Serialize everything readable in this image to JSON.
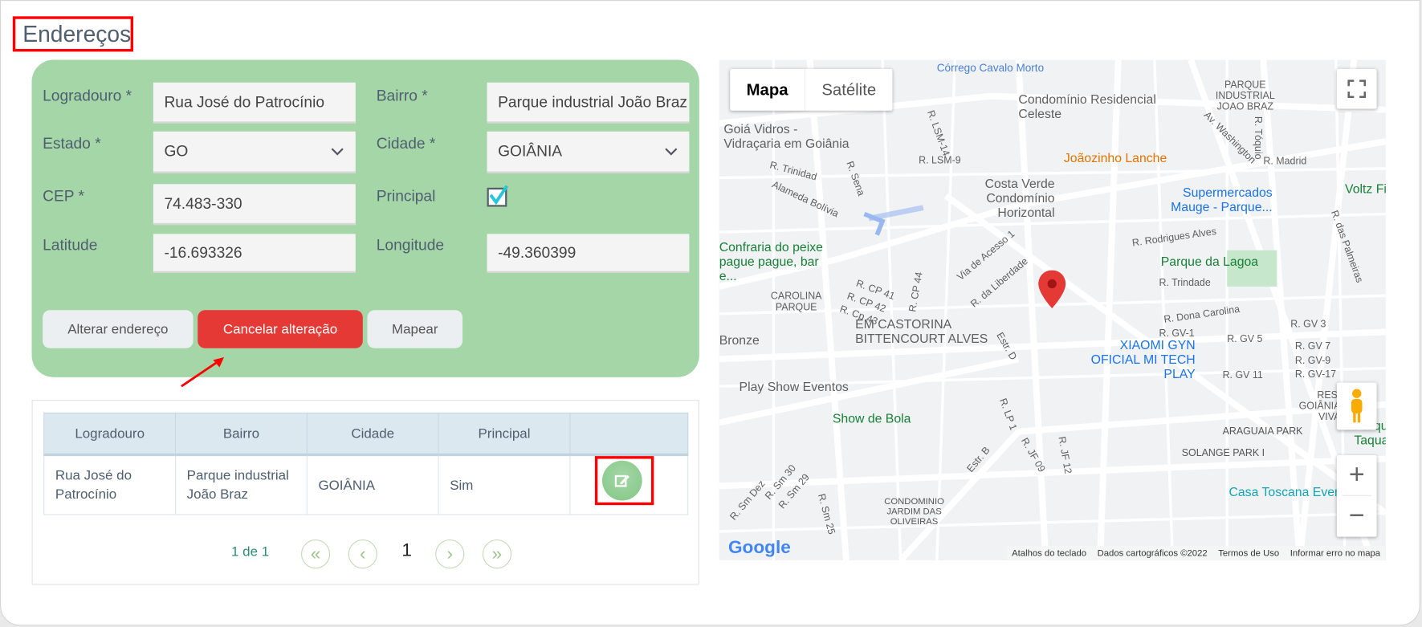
{
  "title": "Endereços",
  "form": {
    "logradouro_label": "Logradouro *",
    "logradouro_value": "Rua José do Patrocínio",
    "bairro_label": "Bairro *",
    "bairro_value": "Parque industrial João Braz",
    "estado_label": "Estado *",
    "estado_value": "GO",
    "cidade_label": "Cidade *",
    "cidade_value": "GOIÂNIA",
    "cep_label": "CEP *",
    "cep_value": "74.483-330",
    "principal_label": "Principal",
    "principal_checked": true,
    "latitude_label": "Latitude",
    "latitude_value": "-16.693326",
    "longitude_label": "Longitude",
    "longitude_value": "-49.360399"
  },
  "buttons": {
    "alterar": "Alterar endereço",
    "cancelar": "Cancelar alteração",
    "mapear": "Mapear"
  },
  "table": {
    "headers": [
      "Logradouro",
      "Bairro",
      "Cidade",
      "Principal",
      ""
    ],
    "rows": [
      {
        "logradouro": "Rua José do Patrocínio",
        "bairro": "Parque industrial João Braz",
        "cidade": "GOIÂNIA",
        "principal": "Sim"
      }
    ]
  },
  "pagination": {
    "summary": "1 de 1",
    "current": "1",
    "first": "«",
    "prev": "‹",
    "next": "›",
    "last": "»"
  },
  "map": {
    "tab_map": "Mapa",
    "tab_satellite": "Satélite",
    "labels": [
      "Córrego Cavalo Morto",
      "Condomínio Residencial Celeste",
      "PARQUE INDUSTRIAL JOAO BRAZ",
      "Goiá Vidros - Vidraçaria em Goiânia",
      "Joãozinho Lanche",
      "R. Madrid",
      "Av. Washington",
      "R. Tóquio",
      "R. LSM-14",
      "R. LSM-9",
      "R. Trinidad",
      "R. Sena",
      "Alameda Bolívia",
      "Costa Verde Condomínio Horizontal",
      "Supermercados Mauge - Parque...",
      "Voltz Fit",
      "Confraria do peixe pague pague, bar e...",
      "R. Rodrigues Alves",
      "Parque da Lagoa",
      "R. Trindade",
      "Via de Acesso 1",
      "R. da Liberdade",
      "CAROLINA PARQUE",
      "R. CP 41",
      "R. CP 42",
      "R. Cp 43",
      "R. CP 44",
      "R. Dona Carolina",
      "EM CASTORINA BITTENCOURT ALVES",
      "Bronze",
      "R. GV-1",
      "R. GV 3",
      "R. GV 5",
      "R. GV 7",
      "R. GV-9",
      "R. GV 11",
      "R. GV-17",
      "XIAOMI GYN OFICIAL MI TECH PLAY",
      "Play Show Eventos",
      "Estr. D",
      "RES. GOIÂNIA VIVA",
      "Show de Bola",
      "R. LP 1",
      "ARAGUAIA PARK",
      "SOLANGE PARK I",
      "Estr. B",
      "R. JF 09",
      "R. JF 12",
      "Casa Toscana Eventos",
      "CONDOMINIO JARDIM DAS OLIVEIRAS",
      "R. Sm 30",
      "R. Sm 29",
      "R. Sm Dez",
      "R. Sm 25",
      "R. das Palmeiras",
      "Parque Taquaral"
    ],
    "attribution": [
      "Atalhos do teclado",
      "Dados cartográficos ©2022",
      "Termos de Uso",
      "Informar erro no mapa"
    ],
    "logo": "Google",
    "zoom_in": "+",
    "zoom_out": "−"
  },
  "colors": {
    "panel": "#a5d6a7",
    "cancel": "#e53935",
    "header": "#dce8f0",
    "highlight": "#ff0000"
  }
}
